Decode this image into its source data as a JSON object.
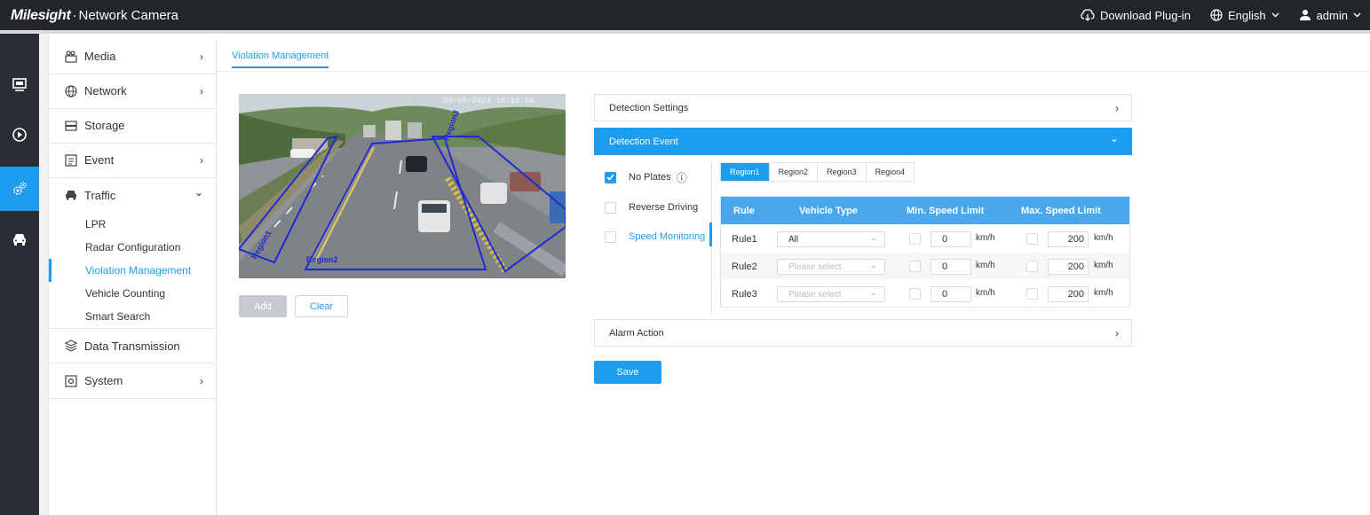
{
  "app": {
    "brand_prefix": "M",
    "brand_rest": "ilesight",
    "brand_dot": "·",
    "product": "Network Camera"
  },
  "topbar": {
    "download": "Download Plug-in",
    "language": "English",
    "user": "admin"
  },
  "rail_icons": [
    "live-view-icon",
    "playback-icon",
    "settings-icon",
    "traffic-icon"
  ],
  "menu": {
    "items": [
      {
        "label": "Media",
        "icon": "media-icon",
        "arrow": "›"
      },
      {
        "label": "Network",
        "icon": "network-icon",
        "arrow": "›"
      },
      {
        "label": "Storage",
        "icon": "storage-icon",
        "arrow": ""
      },
      {
        "label": "Event",
        "icon": "event-icon",
        "arrow": "›"
      },
      {
        "label": "Traffic",
        "icon": "car-icon",
        "arrow": "⌄"
      },
      {
        "label": "Data Transmission",
        "icon": "data-transmission-icon",
        "arrow": ""
      },
      {
        "label": "System",
        "icon": "system-icon",
        "arrow": "›"
      }
    ],
    "traffic_sub": [
      "LPR",
      "Radar Configuration",
      "Violation Management",
      "Vehicle Counting",
      "Smart Search"
    ],
    "active_sub": "Violation Management"
  },
  "tab": "Violation Management",
  "preview": {
    "timestamp": "09/09/2024 16:16:54",
    "regions": [
      "Region1",
      "Region2",
      "Region3"
    ]
  },
  "buttons": {
    "add": "Add",
    "clear": "Clear",
    "save": "Save"
  },
  "panels": {
    "detection_settings": "Detection Settings",
    "detection_event": "Detection Event",
    "alarm_action": "Alarm Action",
    "chev_right": "›",
    "chev_down": "⌄"
  },
  "events": [
    {
      "label": "No Plates",
      "checked": true,
      "info": "ⓘ"
    },
    {
      "label": "Reverse Driving",
      "checked": false
    },
    {
      "label": "Speed Monitoring",
      "checked": false,
      "selected": true
    }
  ],
  "region_tabs": [
    "Region1",
    "Region2",
    "Region3",
    "Region4"
  ],
  "rules_table": {
    "headers": [
      "Rule",
      "Vehicle Type",
      "Min. Speed Limit",
      "Max. Speed Limit"
    ],
    "unit": "km/h",
    "rows": [
      {
        "rule": "Rule1",
        "vehicle": "All",
        "vehicle_placeholder": false,
        "min": "0",
        "max": "200"
      },
      {
        "rule": "Rule2",
        "vehicle": "Please select",
        "vehicle_placeholder": true,
        "min": "0",
        "max": "200"
      },
      {
        "rule": "Rule3",
        "vehicle": "Please select",
        "vehicle_placeholder": true,
        "min": "0",
        "max": "200"
      }
    ]
  },
  "colors": {
    "accent": "#1e9cee",
    "topbar": "#22252a",
    "rail": "#2a2d33",
    "region_line": "#1f2ad6"
  }
}
